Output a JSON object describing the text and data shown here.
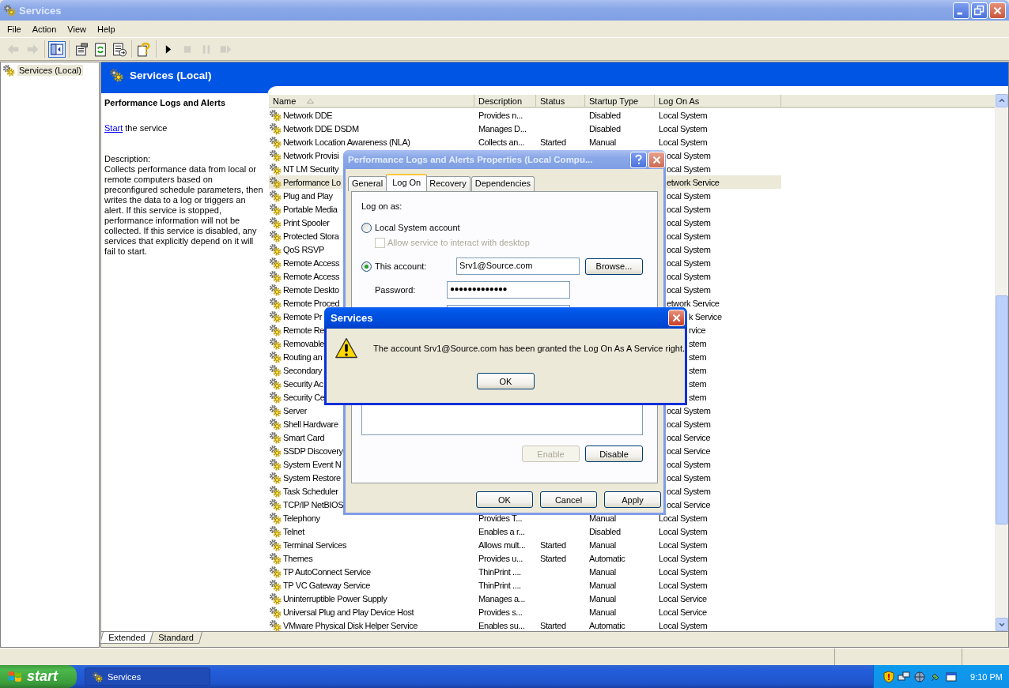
{
  "window": {
    "title": "Services"
  },
  "menu": [
    "File",
    "Action",
    "View",
    "Help"
  ],
  "toolbar": [
    [
      {
        "kind": "back",
        "disabled": true,
        "pressed": false
      },
      {
        "kind": "forward",
        "disabled": true,
        "pressed": false
      }
    ],
    [
      {
        "kind": "tree",
        "disabled": false,
        "pressed": true
      }
    ],
    [
      {
        "kind": "properties",
        "disabled": false,
        "pressed": false
      },
      {
        "kind": "refresh",
        "disabled": false,
        "pressed": false
      },
      {
        "kind": "export",
        "disabled": false,
        "pressed": false
      }
    ],
    [
      {
        "kind": "help",
        "disabled": false,
        "pressed": false
      }
    ],
    [
      {
        "kind": "start",
        "disabled": false,
        "pressed": false
      },
      {
        "kind": "stop",
        "disabled": true,
        "pressed": false
      },
      {
        "kind": "pause",
        "disabled": true,
        "pressed": false
      },
      {
        "kind": "restart",
        "disabled": true,
        "pressed": false
      }
    ]
  ],
  "tree": [
    {
      "label": "Services (Local)",
      "selected": true
    }
  ],
  "header": {
    "title": "Services (Local)"
  },
  "details": {
    "title": "Performance Logs and Alerts",
    "link": "Start",
    "link_rest": "the service",
    "description_label": "Description:",
    "description": "Collects performance data from local or remote computers based on preconfigured schedule parameters, then writes the data to a log or triggers an alert. If this service is stopped, performance information will not be collected. If this service is disabled, any services that explicitly depend on it will fail to start."
  },
  "table": {
    "columns": [
      "Name",
      "Description",
      "Status",
      "Startup Type",
      "Log On As"
    ],
    "rows": [
      {
        "kind": "full",
        "name": "Network DDE",
        "description": "Provides n...",
        "startup_type": "Disabled",
        "log_on_as": "Local System",
        "selected": false
      },
      {
        "kind": "full",
        "name": "Network DDE DSDM",
        "description": "Manages D...",
        "startup_type": "Disabled",
        "log_on_as": "Local System",
        "selected": false
      },
      {
        "kind": "full",
        "name": "Network Location Awareness (NLA)",
        "description": "Collects an...",
        "status": "Started",
        "startup_type": "Manual",
        "log_on_as": "Local System",
        "selected": false
      },
      {
        "kind": "behind_dialog",
        "name": "Network Provisi",
        "log_on_as": "ocal System",
        "selected": false
      },
      {
        "kind": "behind_dialog",
        "name": "NT LM Security",
        "log_on_as": "ocal System",
        "selected": false
      },
      {
        "kind": "behind_dialog",
        "name": "Performance Lo",
        "log_on_as": "etwork Service",
        "selected": true
      },
      {
        "kind": "behind_dialog",
        "name": "Plug and Play",
        "log_on_as": "ocal System",
        "selected": false
      },
      {
        "kind": "behind_dialog",
        "name": "Portable Media",
        "log_on_as": "ocal System",
        "selected": false
      },
      {
        "kind": "behind_dialog",
        "name": "Print Spooler",
        "log_on_as": "ocal System",
        "selected": false
      },
      {
        "kind": "behind_dialog",
        "name": "Protected Stora",
        "log_on_as": "ocal System",
        "selected": false
      },
      {
        "kind": "behind_dialog",
        "name": "QoS RSVP",
        "log_on_as": "ocal System",
        "selected": false
      },
      {
        "kind": "behind_dialog",
        "name": "Remote Access",
        "log_on_as": "ocal System",
        "selected": false
      },
      {
        "kind": "behind_dialog",
        "name": "Remote Access",
        "log_on_as": "ocal System",
        "selected": false
      },
      {
        "kind": "behind_dialog",
        "name": "Remote Deskto",
        "log_on_as": "ocal System",
        "selected": false
      },
      {
        "kind": "behind_dialog",
        "name": "Remote Proced",
        "log_on_as": "etwork Service",
        "selected": false
      },
      {
        "kind": "behind_message",
        "name": "Remote Pr",
        "log_on_as": "k Service",
        "selected": false
      },
      {
        "kind": "behind_message",
        "name": "Remote Re",
        "log_on_as": "rvice",
        "selected": false
      },
      {
        "kind": "behind_message",
        "name": "Removable",
        "log_on_as": "stem",
        "selected": false
      },
      {
        "kind": "behind_message",
        "name": "Routing an",
        "log_on_as": "stem",
        "selected": false
      },
      {
        "kind": "behind_message",
        "name": "Secondary",
        "log_on_as": "stem",
        "selected": false
      },
      {
        "kind": "behind_message",
        "name": "Security Ac",
        "log_on_as": "stem",
        "selected": false
      },
      {
        "kind": "behind_message",
        "name": "Security Ce",
        "log_on_as": "stem",
        "selected": false
      },
      {
        "kind": "behind_dialog",
        "name": "Server",
        "log_on_as": "ocal System",
        "selected": false
      },
      {
        "kind": "behind_dialog",
        "name": "Shell Hardware",
        "log_on_as": "ocal System",
        "selected": false
      },
      {
        "kind": "behind_dialog",
        "name": "Smart Card",
        "log_on_as": "ocal Service",
        "selected": false
      },
      {
        "kind": "behind_dialog",
        "name": "SSDP Discovery",
        "log_on_as": "ocal Service",
        "selected": false
      },
      {
        "kind": "behind_dialog",
        "name": "System Event N",
        "log_on_as": "ocal System",
        "selected": false
      },
      {
        "kind": "behind_dialog",
        "name": "System Restore",
        "log_on_as": "ocal System",
        "selected": false
      },
      {
        "kind": "behind_dialog",
        "name": "Task Scheduler",
        "log_on_as": "ocal System",
        "selected": false
      },
      {
        "kind": "behind_dialog",
        "name": "TCP/IP NetBIOS",
        "log_on_as": "ocal Service",
        "selected": false
      },
      {
        "kind": "full",
        "name": "Telephony",
        "description": "Provides T...",
        "startup_type": "Manual",
        "log_on_as": "Local System",
        "selected": false
      },
      {
        "kind": "full",
        "name": "Telnet",
        "description": "Enables a r...",
        "startup_type": "Disabled",
        "log_on_as": "Local System",
        "selected": false
      },
      {
        "kind": "full",
        "name": "Terminal Services",
        "description": "Allows mult...",
        "status": "Started",
        "startup_type": "Manual",
        "log_on_as": "Local System",
        "selected": false
      },
      {
        "kind": "full",
        "name": "Themes",
        "description": "Provides u...",
        "status": "Started",
        "startup_type": "Automatic",
        "log_on_as": "Local System",
        "selected": false
      },
      {
        "kind": "full",
        "name": "TP AutoConnect Service",
        "description": "ThinPrint ....",
        "startup_type": "Manual",
        "log_on_as": "Local System",
        "selected": false
      },
      {
        "kind": "full",
        "name": "TP VC Gateway Service",
        "description": "ThinPrint ....",
        "startup_type": "Manual",
        "log_on_as": "Local System",
        "selected": false
      },
      {
        "kind": "full",
        "name": "Uninterruptible Power Supply",
        "description": "Manages a...",
        "startup_type": "Manual",
        "log_on_as": "Local Service",
        "selected": false
      },
      {
        "kind": "full",
        "name": "Universal Plug and Play Device Host",
        "description": "Provides s...",
        "startup_type": "Manual",
        "log_on_as": "Local Service",
        "selected": false
      },
      {
        "kind": "full",
        "name": "VMware Physical Disk Helper Service",
        "description": "Enables su...",
        "status": "Started",
        "startup_type": "Automatic",
        "log_on_as": "Local System",
        "selected": false
      }
    ]
  },
  "view_tabs": [
    {
      "label": "Extended",
      "selected": true
    },
    {
      "label": "Standard",
      "selected": false
    }
  ],
  "properties_dialog": {
    "title": "Performance Logs and Alerts Properties (Local Compu...",
    "tabs": [
      {
        "label": "General",
        "selected": false
      },
      {
        "label": "Log On",
        "selected": true
      },
      {
        "label": "Recovery",
        "selected": false
      },
      {
        "label": "Dependencies",
        "selected": false
      }
    ],
    "log_on_label": "Log on as:",
    "options": [
      {
        "label": "Local System account",
        "selected": false
      },
      {
        "label": "This account:",
        "selected": true
      }
    ],
    "interact_checkbox": {
      "label": "Allow service to interact with desktop",
      "checked": false,
      "disabled": true
    },
    "account": {
      "value": "Srv1@Source.com"
    },
    "browse_button": "Browse...",
    "password": {
      "label": "Password:",
      "value": "●●●●●●●●●●●●●"
    },
    "profile_buttons": [
      {
        "label": "Enable",
        "disabled": true
      },
      {
        "label": "Disable",
        "disabled": false
      }
    ],
    "buttons": [
      "OK",
      "Cancel",
      "Apply"
    ]
  },
  "message_box": {
    "title": "Services",
    "message": "The account Srv1@Source.com has been granted the Log On As A Service right.",
    "button": "OK"
  },
  "taskbar": {
    "start": "start",
    "tasks": [
      {
        "label": "Services",
        "selected": true
      }
    ],
    "clock": "9:10 PM"
  }
}
